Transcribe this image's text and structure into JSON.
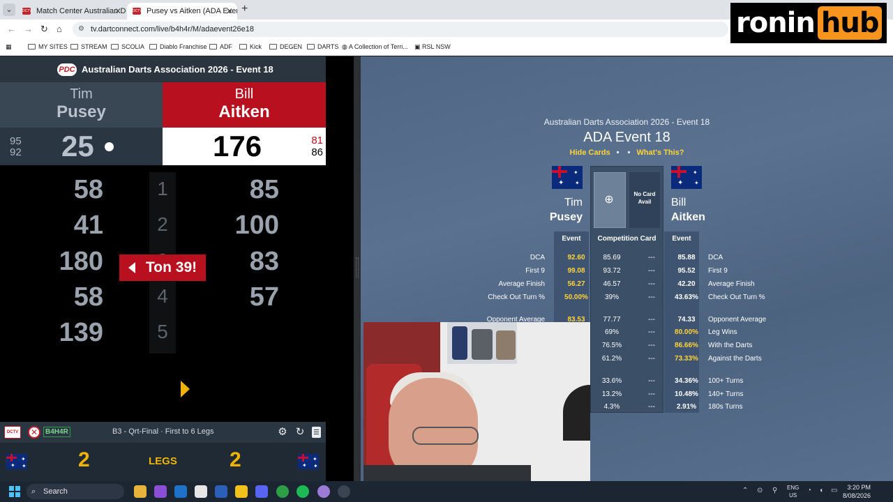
{
  "browser": {
    "tabs": [
      {
        "label": "Match Center Australian Darts A",
        "active": false
      },
      {
        "label": "Pusey vs Aitken (ADA Event 18)",
        "active": true
      }
    ],
    "url": "tv.dartconnect.com/live/b4h4r/M/adaevent26e18",
    "bookmarks": [
      "MY SITES",
      "STREAM",
      "SCOLIA",
      "Diablo Franchise",
      "ADF",
      "Kick",
      "DEGEN",
      "DARTS",
      "A Collection of Terri...",
      "RSL NSW"
    ]
  },
  "overlay": {
    "brand_part1": "ronin",
    "brand_part2": "hub"
  },
  "scoreboard": {
    "title": "Australian Darts Association 2026 - Event 18",
    "logo": "PDC",
    "left_player": {
      "first": "Tim",
      "last": "Pusey",
      "score": "25",
      "avg1": "95",
      "avg2": "92"
    },
    "right_player": {
      "first": "Bill",
      "last": "Aitken",
      "score": "176",
      "avg1": "81",
      "avg2": "86"
    },
    "rounds": [
      {
        "num": "1",
        "left": "58",
        "right": "85"
      },
      {
        "num": "2",
        "left": "41",
        "right": "100"
      },
      {
        "num": "3",
        "left": "180",
        "right": "83"
      },
      {
        "num": "4",
        "left": "58",
        "right": "57"
      },
      {
        "num": "5",
        "left": "139",
        "right": ""
      }
    ],
    "callout": "Ton 39!",
    "dctv_logo": "DCTV",
    "match_code": "B4H4R",
    "match_label": "B3 - Qrt-Final · First to 6 Legs",
    "legs_left": "2",
    "legs_right": "2",
    "legs_label": "LEGS"
  },
  "stats": {
    "subtitle": "Australian Darts Association 2026 - Event 18",
    "title": "ADA Event 18",
    "link_hide": "Hide Cards",
    "link_whats": "What's This?",
    "left_first": "Tim",
    "left_last": "Pusey",
    "right_first": "Bill",
    "right_last": "Aitken",
    "no_card": "No Card Avail",
    "col_event": "Event",
    "col_comp": "Competition Card",
    "rows": [
      {
        "label": "DCA",
        "ev": "92.60",
        "cc": "85.69",
        "cc2": "---",
        "rv": "85.88",
        "rlabel": "DCA",
        "ry": false
      },
      {
        "label": "First 9",
        "ev": "99.08",
        "cc": "93.72",
        "cc2": "---",
        "rv": "95.52",
        "rlabel": "First 9",
        "ry": false
      },
      {
        "label": "Average Finish",
        "ev": "56.27",
        "cc": "46.57",
        "cc2": "---",
        "rv": "42.20",
        "rlabel": "Average Finish",
        "ry": false
      },
      {
        "label": "Check Out Turn %",
        "ev": "50.00%",
        "cc": "39%",
        "cc2": "---",
        "rv": "43.63%",
        "rlabel": "Check Out Turn %",
        "ry": false
      },
      {
        "label": "Opponent Average",
        "ev": "83.53",
        "cc": "77.77",
        "cc2": "---",
        "rv": "74.33",
        "rlabel": "Opponent Average",
        "ry": false
      },
      {
        "label": "",
        "ev": "",
        "cc": "69%",
        "cc2": "---",
        "rv": "80.00%",
        "rlabel": "Leg Wins",
        "ry": true
      },
      {
        "label": "",
        "ev": "",
        "cc": "76.5%",
        "cc2": "---",
        "rv": "86.66%",
        "rlabel": "With the Darts",
        "ry": true
      },
      {
        "label": "",
        "ev": "",
        "cc": "61.2%",
        "cc2": "---",
        "rv": "73.33%",
        "rlabel": "Against the Darts",
        "ry": true
      },
      {
        "label": "",
        "ev": "",
        "cc": "33.6%",
        "cc2": "---",
        "rv": "34.36%",
        "rlabel": "100+ Turns",
        "ry": false
      },
      {
        "label": "",
        "ev": "",
        "cc": "13.2%",
        "cc2": "---",
        "rv": "10.48%",
        "rlabel": "140+ Turns",
        "ry": false
      },
      {
        "label": "",
        "ev": "",
        "cc": "4.3%",
        "cc2": "---",
        "rv": "2.91%",
        "rlabel": "180s Turns",
        "ry": false
      }
    ]
  },
  "taskbar": {
    "search": "Search",
    "lang1": "ENG",
    "lang2": "US",
    "time": "3:20 PM",
    "date": "8/08/2026"
  }
}
